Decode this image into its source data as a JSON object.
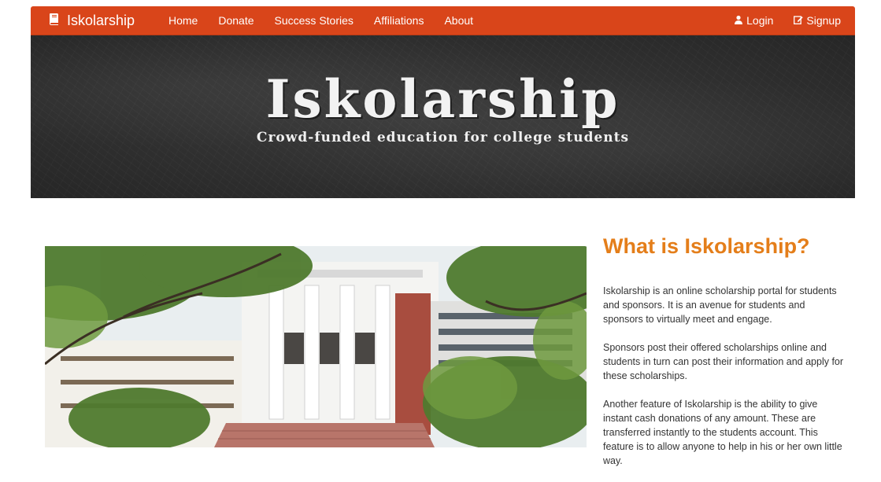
{
  "navbar": {
    "brand": "Iskolarship",
    "links": [
      "Home",
      "Donate",
      "Success Stories",
      "Affiliations",
      "About"
    ],
    "login": "Login",
    "signup": "Signup",
    "color": "#d9451a"
  },
  "hero": {
    "title": "Iskolarship",
    "subtitle": "Crowd-funded education for college students"
  },
  "about": {
    "heading": "What is Iskolarship?",
    "heading_color": "#e47e1a",
    "paragraphs": [
      "Iskolarship is an online scholarship portal for students and sponsors. It is an avenue for students and sponsors to virtually meet and engage.",
      "Sponsors post their offered scholarships online and students in turn can post their information and apply for these scholarships.",
      "Another feature of Iskolarship is the ability to give instant cash donations of any amount. These are transferred instantly to the students account. This feature is to allow anyone to help in his or her own little way."
    ]
  },
  "icons": {
    "brand": "book-icon",
    "login": "user-icon",
    "signup": "edit-icon"
  }
}
